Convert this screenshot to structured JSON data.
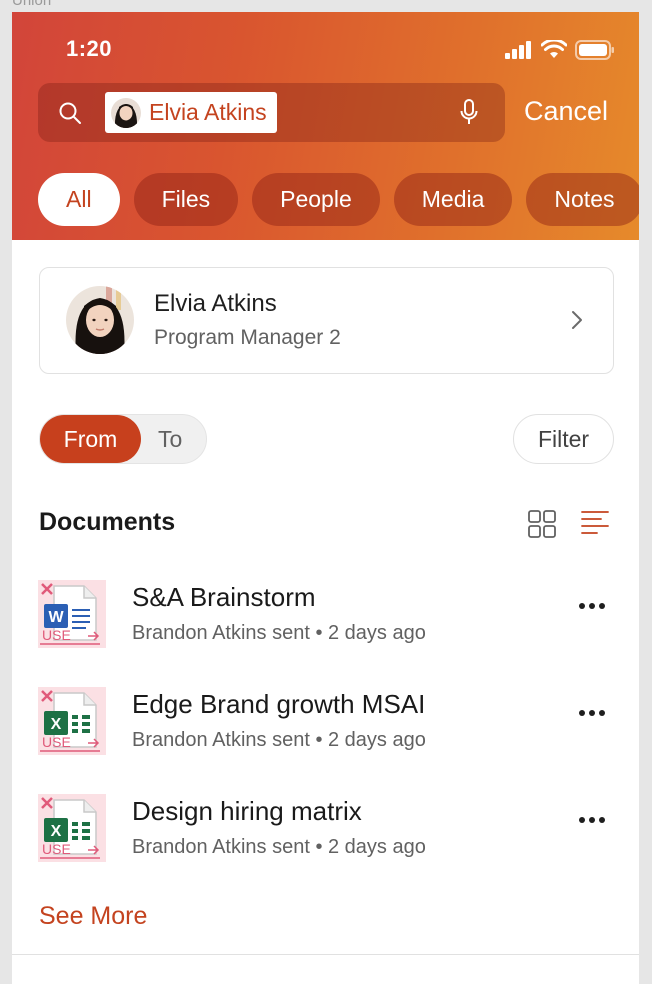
{
  "frame_label": "Union",
  "status": {
    "time": "1:20"
  },
  "search": {
    "chip_name": "Elvia Atkins",
    "cancel_label": "Cancel"
  },
  "tabs": [
    {
      "label": "All",
      "active": true
    },
    {
      "label": "Files"
    },
    {
      "label": "People"
    },
    {
      "label": "Media"
    },
    {
      "label": "Notes"
    }
  ],
  "person": {
    "name": "Elvia Atkins",
    "title": "Program Manager 2"
  },
  "direction_toggle": {
    "from_label": "From",
    "to_label": "To",
    "selected": "From"
  },
  "filter_label": "Filter",
  "documents": {
    "title": "Documents",
    "items": [
      {
        "name": "S&A Brainstorm",
        "meta": "Brandon Atkins sent • 2 days ago",
        "app": "word",
        "app_letter": "W",
        "watermark": "USE"
      },
      {
        "name": "Edge Brand growth MSAI",
        "meta": "Brandon Atkins sent • 2 days ago",
        "app": "excel",
        "app_letter": "X",
        "watermark": "USE"
      },
      {
        "name": "Design hiring matrix",
        "meta": "Brandon Atkins sent • 2 days ago",
        "app": "excel",
        "app_letter": "X",
        "watermark": "USE"
      }
    ],
    "see_more_label": "See More"
  },
  "colors": {
    "accent": "#c4431f",
    "header_start": "#d2453a",
    "header_end": "#e68a2b",
    "word_blue": "#2b5fb4",
    "excel_green": "#1e7145"
  }
}
